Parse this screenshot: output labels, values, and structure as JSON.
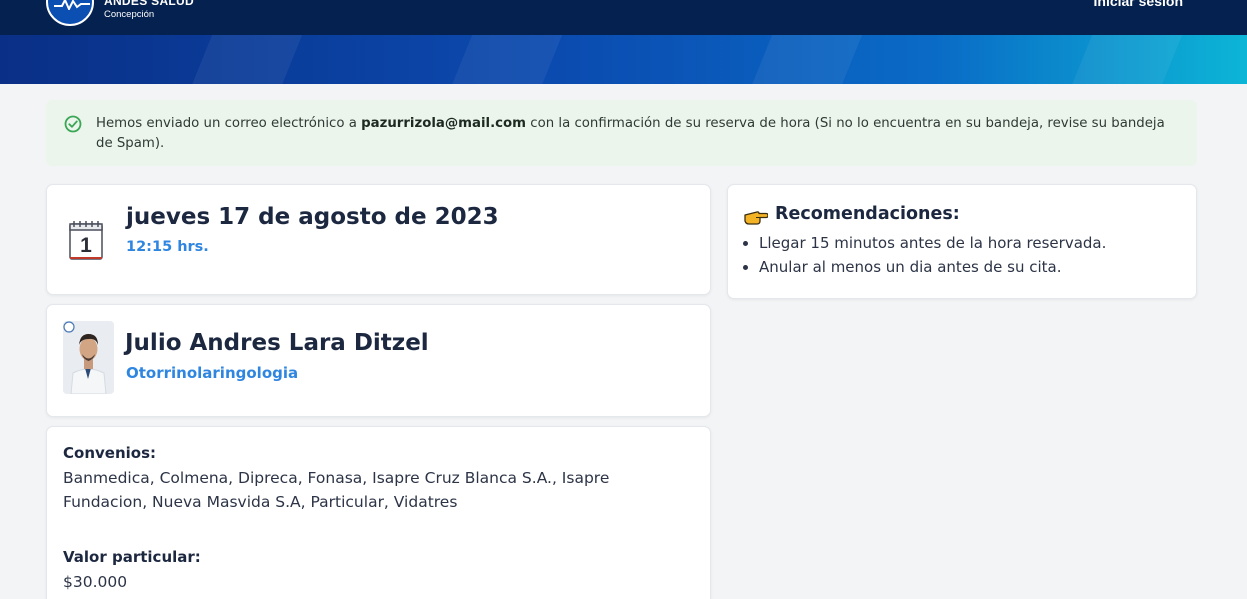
{
  "header": {
    "brand_name": "ANDES SALUD",
    "brand_city": "Concepción",
    "login_label": "Iniciar sesión"
  },
  "alert": {
    "text_before": "Hemos enviado un correo electrónico a ",
    "email": "pazurrizola@mail.com",
    "text_after": " con la confirmación de su reserva de hora (Si no lo encuentra en su bandeja, revise su bandeja de Spam).",
    "icon": "check-circle-icon"
  },
  "appointment": {
    "calendar_day": "1",
    "date": "jueves 17 de agosto de 2023",
    "time": "12:15 hrs."
  },
  "doctor": {
    "name": "Julio Andres Lara Ditzel",
    "specialty": "Otorrinolaringologia"
  },
  "info": {
    "agreements_label": "Convenios:",
    "agreements_text": "Banmedica, Colmena, Dipreca, Fonasa, Isapre Cruz Blanca S.A., Isapre Fundacion, Nueva Masvida S.A, Particular, Vidatres",
    "price_label": "Valor particular:",
    "price_value": "$30.000"
  },
  "recommendations": {
    "icon": "pointing-hand-icon",
    "title": "Recomendaciones:",
    "items": [
      "Llegar 15 minutos antes de la hora reservada.",
      "Anular al menos un dia antes de su cita."
    ]
  },
  "colors": {
    "navy": "#04214f",
    "accent_blue": "#2f86e0",
    "success_bg": "#ecf5ec",
    "success_icon": "#3aa757"
  }
}
